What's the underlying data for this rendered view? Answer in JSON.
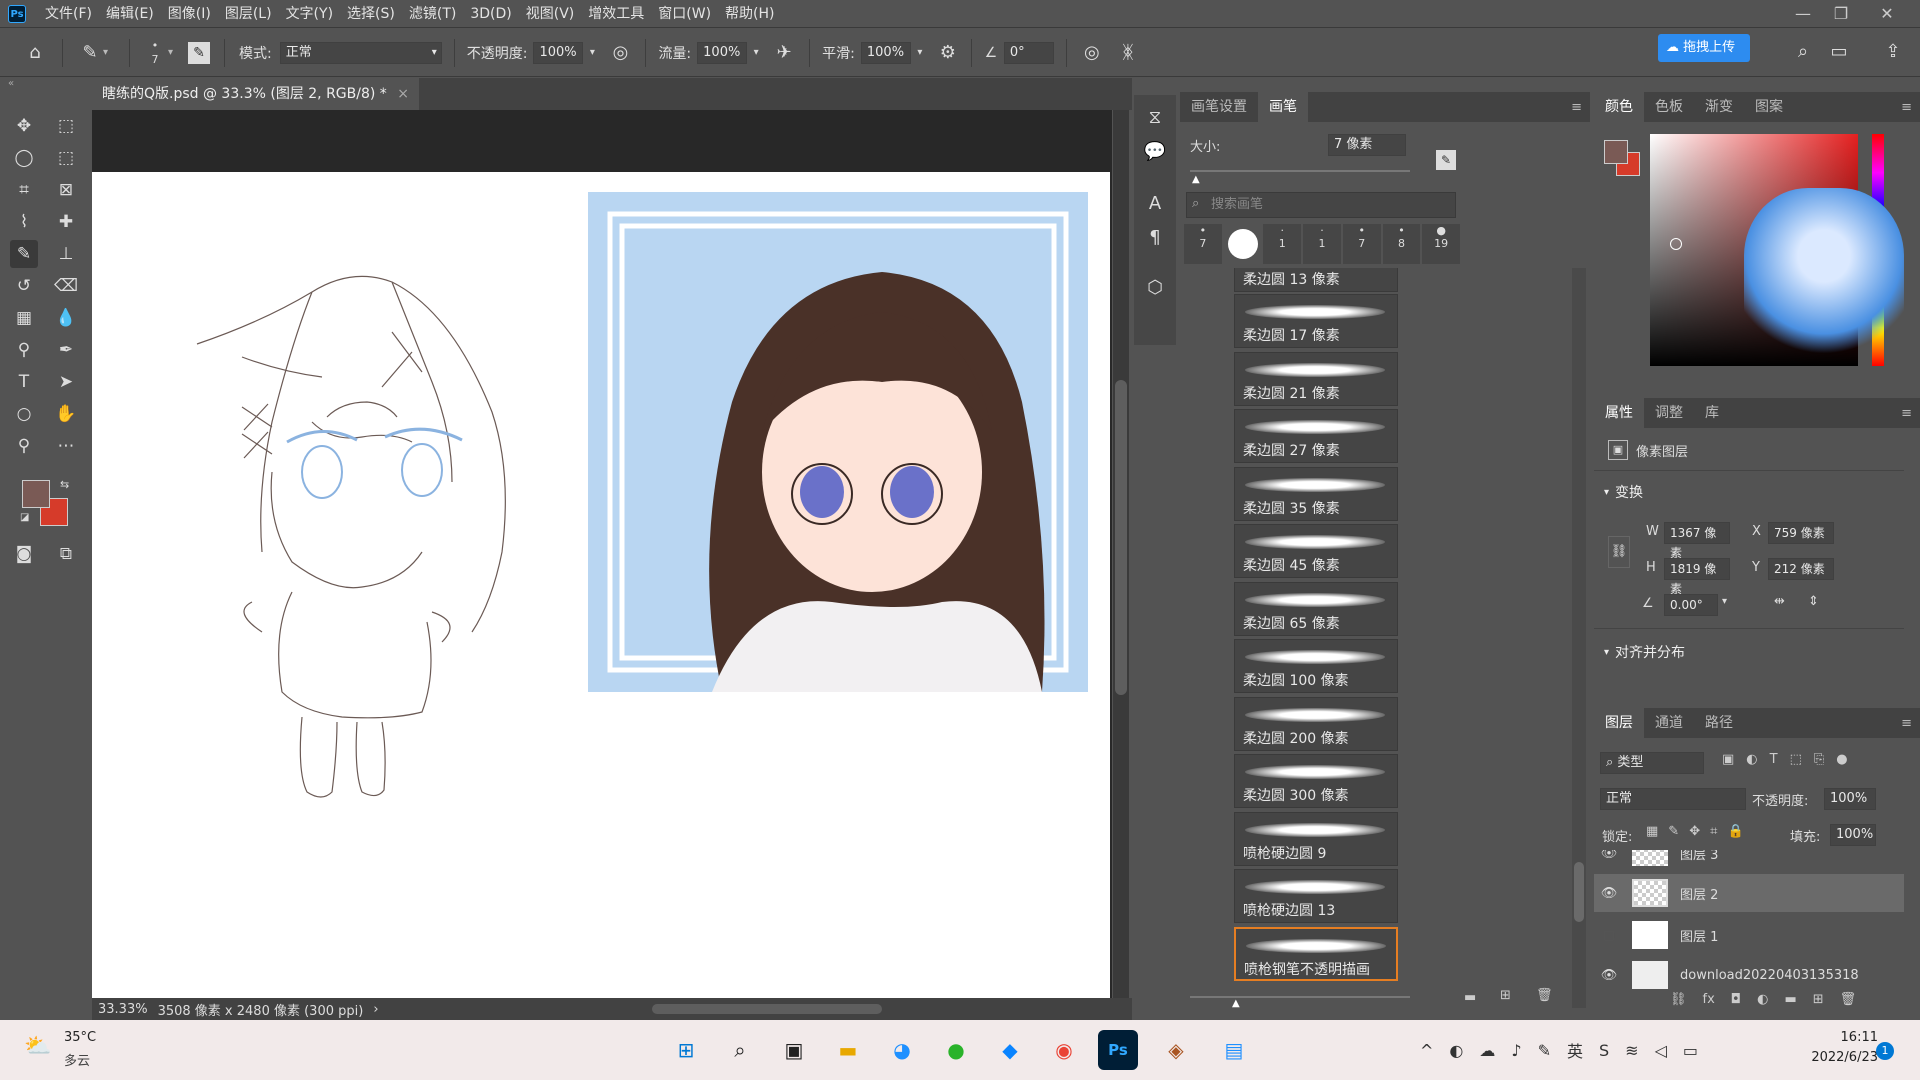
{
  "menubar": {
    "logo": "Ps",
    "items": [
      "文件(F)",
      "编辑(E)",
      "图像(I)",
      "图层(L)",
      "文字(Y)",
      "选择(S)",
      "滤镜(T)",
      "3D(D)",
      "视图(V)",
      "增效工具",
      "窗口(W)",
      "帮助(H)"
    ]
  },
  "options": {
    "brush_size": "7",
    "mode_label": "模式:",
    "mode_value": "正常",
    "opacity_label": "不透明度:",
    "opacity_value": "100%",
    "flow_label": "流量:",
    "flow_value": "100%",
    "smooth_label": "平滑:",
    "smooth_value": "100%",
    "angle_value": "0°",
    "upload_label": "拖拽上传"
  },
  "document": {
    "tab_title": "瞎练的Q版.psd @ 33.3% (图层 2, RGB/8) *",
    "zoom": "33.33%",
    "size_info": "3508 像素 x 2480 像素 (300 ppi)"
  },
  "brush_panel": {
    "tabs": [
      "画笔设置",
      "画笔"
    ],
    "size_label": "大小:",
    "size_value": "7 像素",
    "search_placeholder": "搜索画笔",
    "presets": [
      "7",
      "",
      "1",
      "1",
      "7",
      "8",
      "19"
    ],
    "brushes": [
      "柔边圆 13 像素",
      "柔边圆 17 像素",
      "柔边圆 21 像素",
      "柔边圆 27 像素",
      "柔边圆 35 像素",
      "柔边圆 45 像素",
      "柔边圆 65 像素",
      "柔边圆 100 像素",
      "柔边圆 200 像素",
      "柔边圆 300 像素",
      "喷枪硬边圆 9",
      "喷枪硬边圆 13",
      "喷枪钢笔不透明描画"
    ]
  },
  "color_panel": {
    "tabs": [
      "颜色",
      "色板",
      "渐变",
      "图案"
    ]
  },
  "props_panel": {
    "tabs": [
      "属性",
      "调整",
      "库"
    ],
    "layer_type": "像素图层",
    "transform_label": "变换",
    "w_label": "W",
    "w_value": "1367 像素",
    "x_label": "X",
    "x_value": "759 像素",
    "h_label": "H",
    "h_value": "1819 像素",
    "y_label": "Y",
    "y_value": "212 像素",
    "angle_value": "0.00°",
    "align_label": "对齐并分布"
  },
  "layers_panel": {
    "tabs": [
      "图层",
      "通道",
      "路径"
    ],
    "filter_label": "类型",
    "blend_mode": "正常",
    "opacity_label": "不透明度:",
    "opacity_value": "100%",
    "lock_label": "锁定:",
    "fill_label": "填充:",
    "fill_value": "100%",
    "layers": [
      "图层 3",
      "图层 2",
      "图层 1",
      "download20220403135318"
    ]
  },
  "taskbar": {
    "temp": "35°C",
    "weather": "多云",
    "time": "16:11",
    "date": "2022/6/23",
    "notif_count": "1"
  },
  "colors": {
    "foreground": "#7a5a55",
    "background": "#d63b2a",
    "accent": "#31a8ff"
  }
}
